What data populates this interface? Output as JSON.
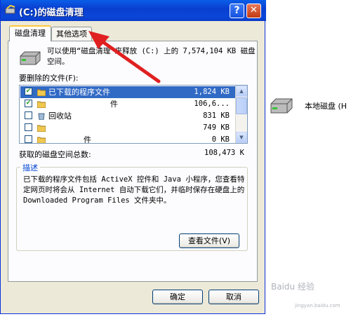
{
  "window": {
    "title": "(C:)的磁盘清理",
    "help_glyph": "?",
    "close_glyph": "✕"
  },
  "tabs": [
    {
      "label": "磁盘清理",
      "active": true
    },
    {
      "label": "其他选项",
      "active": false
    }
  ],
  "intro_text": "可以使用“磁盘清理”来释放 (C:) 上的 7,574,104 KB 磁盘空间。",
  "files_label": "要删除的文件(F):",
  "files": [
    {
      "name": "已下载的程序文件",
      "size": "1,824 KB",
      "checked": true,
      "selected": true
    },
    {
      "name": "件",
      "size": "106,6...",
      "checked": true,
      "selected": false
    },
    {
      "name": "回收站",
      "size": "831 KB",
      "checked": false,
      "selected": false
    },
    {
      "name": "",
      "size": "749 KB",
      "checked": false,
      "selected": false
    },
    {
      "name": "件",
      "size": "0 KB",
      "checked": false,
      "selected": false
    }
  ],
  "total_label": "获取的磁盘空间总数:",
  "total_value": "108,473 K",
  "description": {
    "title": "描述",
    "text": "已下载的程序文件包括 ActiveX 控件和 Java 小程序，您查看特定网页时将会从 Internet 自动下载它们，并临时保存在硬盘上的 Downloaded Program Files 文件夹中。"
  },
  "buttons": {
    "view_files": "查看文件(V)",
    "ok": "确定",
    "cancel": "取消"
  },
  "desktop": {
    "drive_label": "本地磁盘 (H"
  },
  "watermark": {
    "text": "Baidu 经验",
    "sub": "jingyan.baidu.com"
  },
  "colors": {
    "titlebar": "#0a46d8",
    "selection": "#316ac5",
    "group_title": "#0046d5",
    "arrow": "#e02020"
  },
  "icons": {
    "title": "disk-cleanup-icon",
    "drive": "hard-drive-icon",
    "row": "folder-icon"
  }
}
